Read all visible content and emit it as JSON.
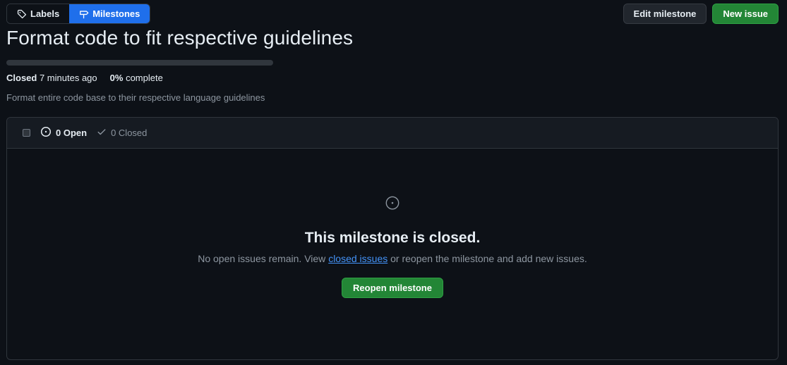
{
  "nav": {
    "labels_tab": "Labels",
    "milestones_tab": "Milestones"
  },
  "actions": {
    "edit_milestone": "Edit milestone",
    "new_issue": "New issue"
  },
  "milestone": {
    "title": "Format code to fit respective guidelines",
    "progress_fraction": 0,
    "status": "Closed",
    "closed_time": "7 minutes ago",
    "percent_complete": "0%",
    "complete_label": "complete",
    "description": "Format entire code base to their respective language guidelines"
  },
  "issues_header": {
    "open_label": "0 Open",
    "closed_label": "0 Closed"
  },
  "blankslate": {
    "title": "This milestone is closed.",
    "text_before": "No open issues remain. View ",
    "link_text": "closed issues",
    "text_after": " or reopen the milestone and add new issues.",
    "button": "Reopen milestone"
  },
  "colors": {
    "accent_blue": "#1f6feb",
    "primary_green": "#238636",
    "link_blue": "#4493f8",
    "background": "#0d1117"
  },
  "icons": {
    "labels_tab": "tag-icon",
    "milestones_tab": "milestone-icon",
    "open_state": "issue-opened-icon",
    "closed_state": "check-icon",
    "blankslate": "issue-opened-icon"
  }
}
